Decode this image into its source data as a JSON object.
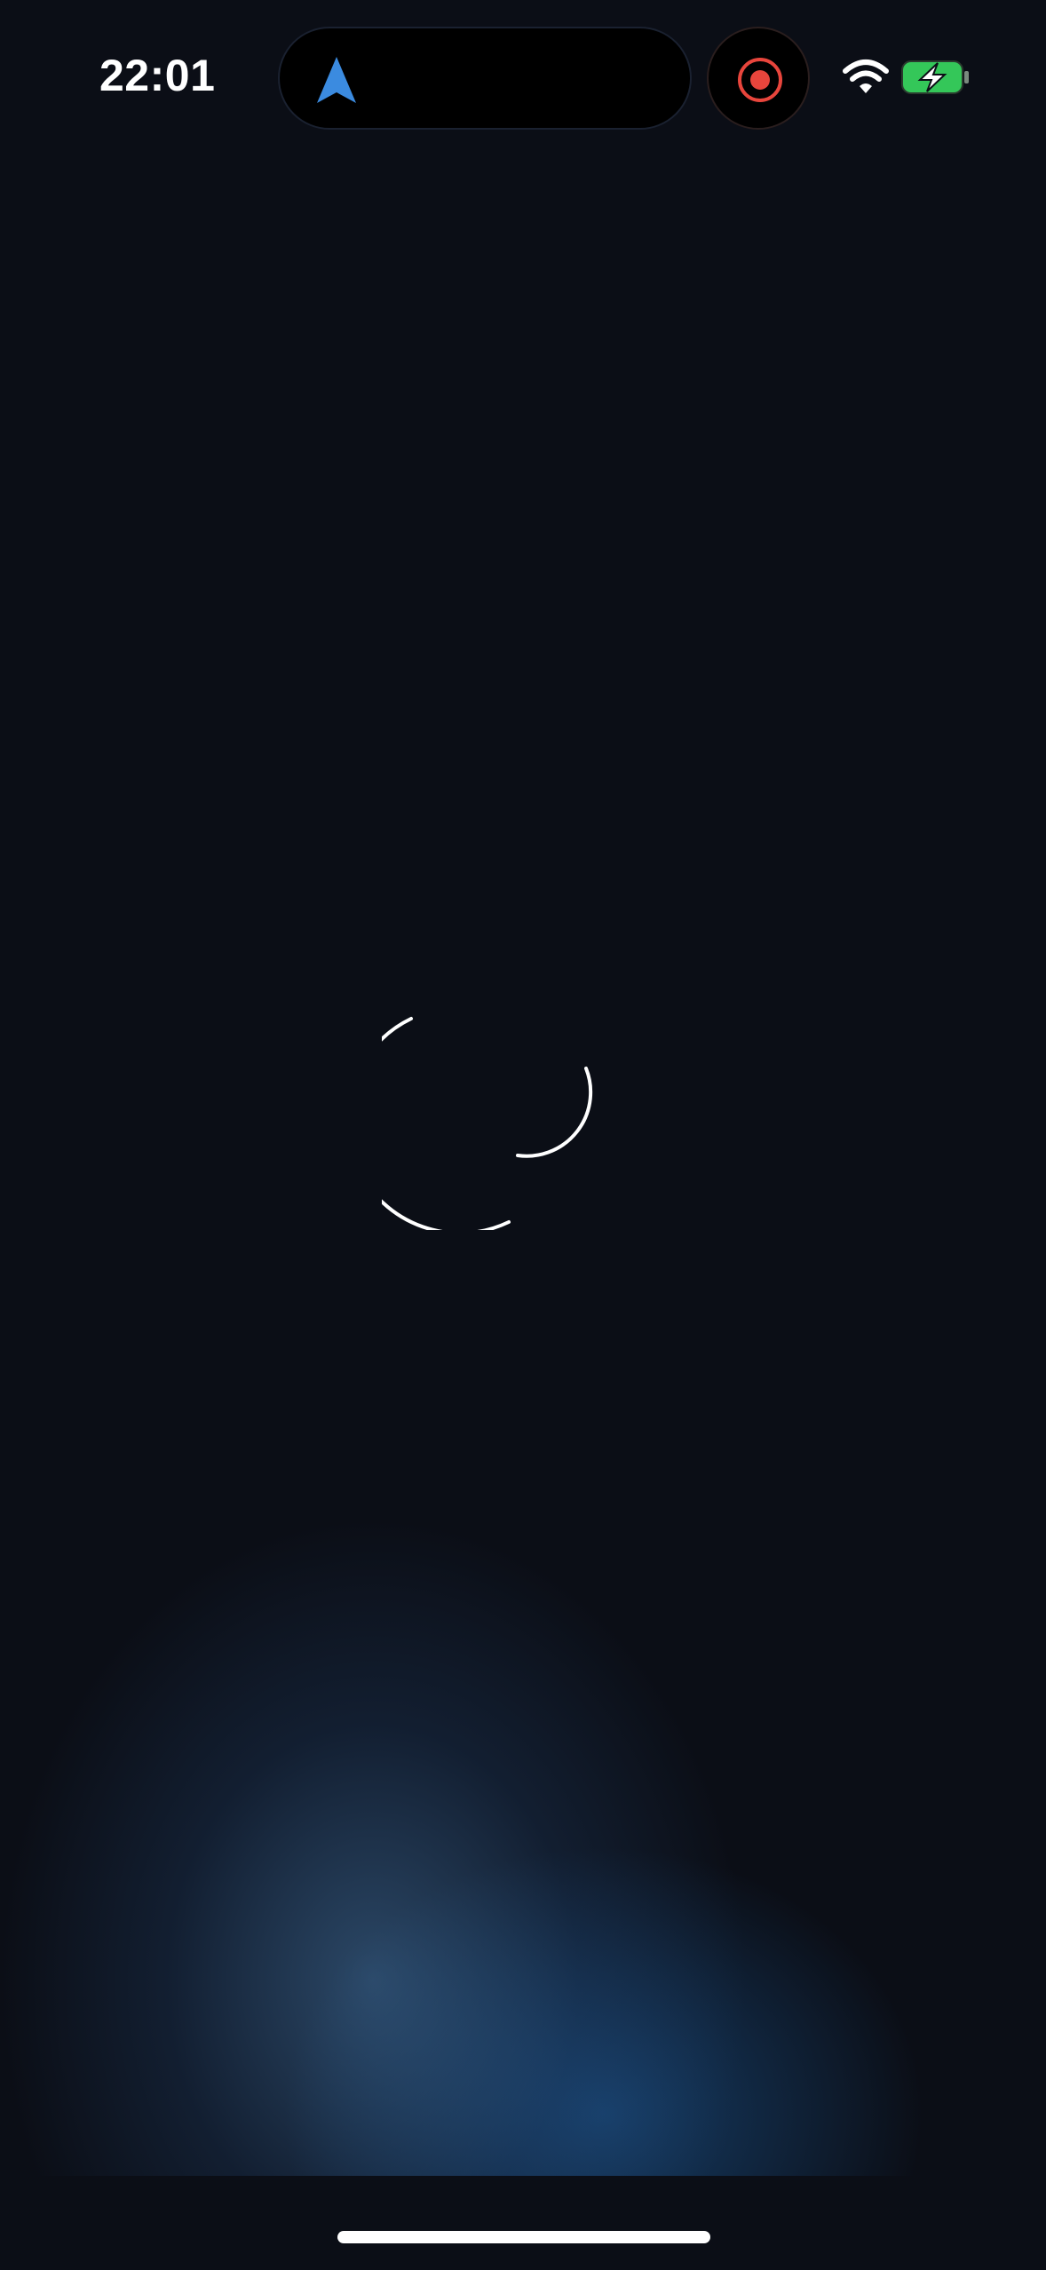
{
  "status_bar": {
    "time": "22:01",
    "icons": [
      "navigation-arrow-icon",
      "screen-recording-icon",
      "wifi-icon",
      "battery-charging-icon"
    ]
  },
  "main": {
    "loading_indicator": "spinner-icon"
  },
  "colors": {
    "background": "#0b0e16",
    "nav_arrow": "#3b8be0",
    "recording": "#e8453c",
    "battery_fill": "#34c759",
    "glow": "#2f6aa3"
  }
}
